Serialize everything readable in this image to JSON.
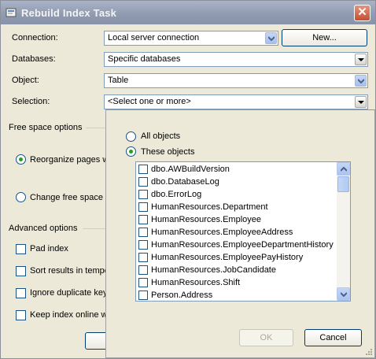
{
  "window": {
    "title": "Rebuild Index Task",
    "close_symbol": "✕"
  },
  "form": {
    "connection_label": "Connection:",
    "connection_value": "Local server connection",
    "new_button": "New...",
    "databases_label": "Databases:",
    "databases_value": "Specific databases",
    "object_label": "Object:",
    "object_value": "Table",
    "selection_label": "Selection:",
    "selection_value": "<Select one or more>"
  },
  "free_space": {
    "heading": "Free space options",
    "reorganize_label": "Reorganize pages w",
    "change_label": "Change free space"
  },
  "advanced": {
    "heading": "Advanced options",
    "pad_index": "Pad index",
    "sort_results": "Sort results in tempo",
    "ignore_duplicate": "Ignore duplicate key",
    "keep_online": "Keep index online w"
  },
  "popup": {
    "all_objects": "All objects",
    "these_objects": "These objects",
    "items": [
      "dbo.AWBuildVersion",
      "dbo.DatabaseLog",
      "dbo.ErrorLog",
      "HumanResources.Department",
      "HumanResources.Employee",
      "HumanResources.EmployeeAddress",
      "HumanResources.EmployeeDepartmentHistory",
      "HumanResources.EmployeePayHistory",
      "HumanResources.JobCandidate",
      "HumanResources.Shift",
      "Person.Address"
    ],
    "ok_button": "OK",
    "cancel_button": "Cancel"
  }
}
